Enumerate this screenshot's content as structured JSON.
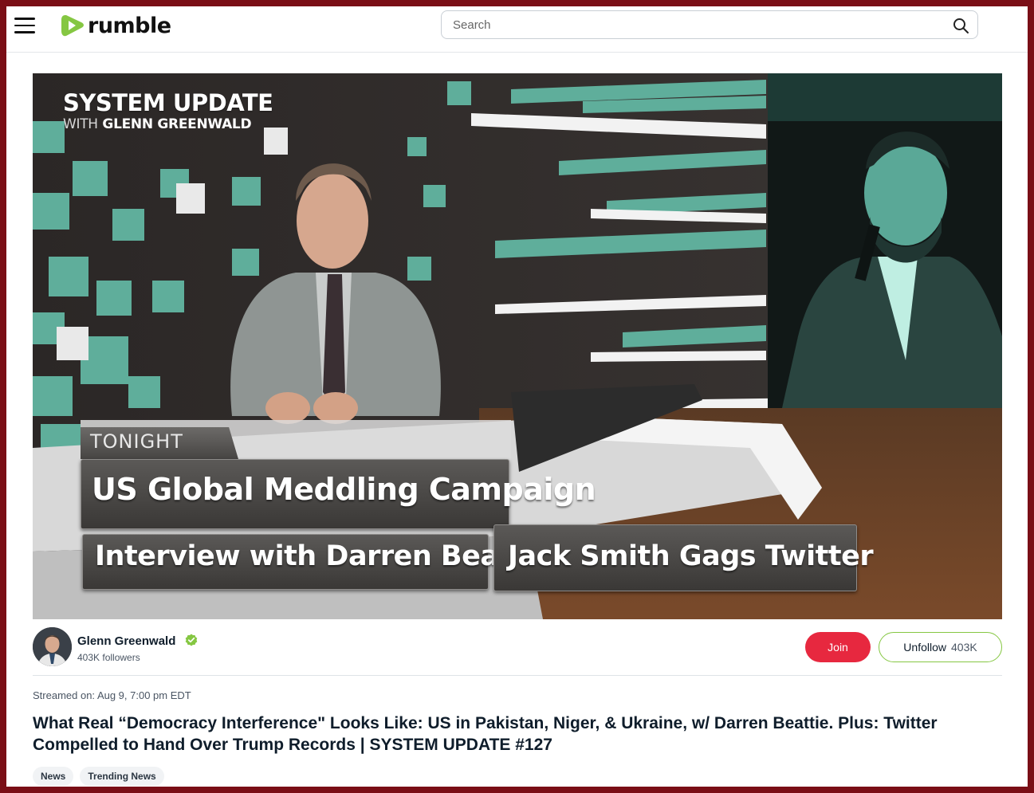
{
  "header": {
    "brand": "rumble",
    "search_placeholder": "Search"
  },
  "video": {
    "show_title": "SYSTEM UPDATE",
    "show_sub_with": "WITH",
    "show_sub_name": "GLENN GREENWALD",
    "tonight_label": "TONIGHT",
    "headline_1": "US Global Meddling Campaign",
    "headline_2": "Interview with Darren Beattie",
    "headline_3": "Jack Smith Gags Twitter"
  },
  "channel": {
    "name": "Glenn Greenwald",
    "followers": "403K followers",
    "join_label": "Join",
    "unfollow_label": "Unfollow",
    "unfollow_count": "403K"
  },
  "meta": {
    "streamed": "Streamed on: Aug 9, 7:00 pm EDT",
    "title": "What Real “Democracy Interference\" Looks Like: US in Pakistan, Niger, & Ukraine, w/ Darren Beattie. Plus: Twitter Compelled to Hand Over Trump Records | SYSTEM UPDATE #127",
    "tags": [
      "News",
      "Trending News"
    ]
  },
  "colors": {
    "brand_green": "#85c742",
    "join_red": "#e7283f",
    "frame_red": "#7a0e16",
    "text_dark": "#0f1d2b"
  }
}
